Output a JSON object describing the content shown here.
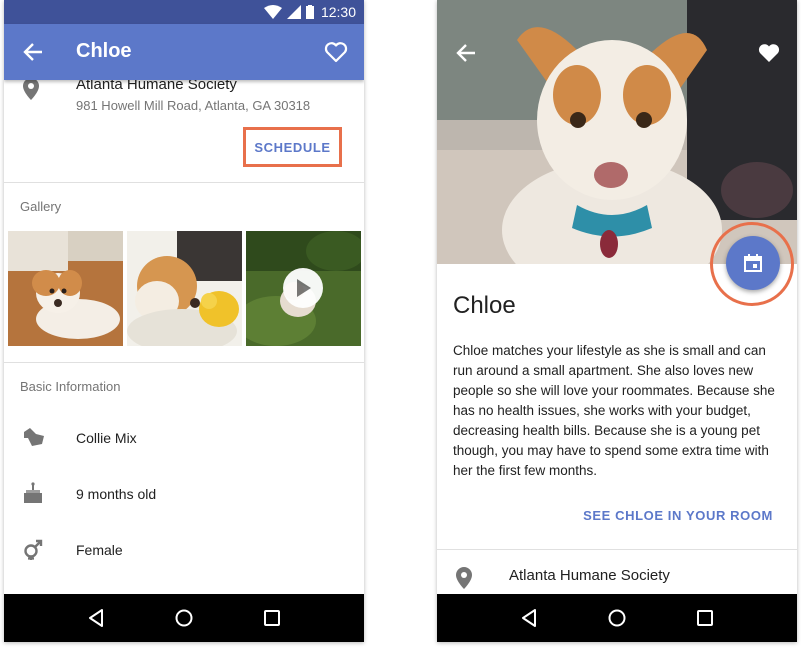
{
  "left_screen": {
    "status_bar": {
      "time": "12:30"
    },
    "app_bar": {
      "title": "Chloe"
    },
    "location": {
      "name": "Atlanta Humane Society",
      "address": "981 Howell Mill Road, Atlanta, GA 30318"
    },
    "schedule_label": "SCHEDULE",
    "gallery": {
      "label": "Gallery",
      "items": [
        "photo",
        "photo",
        "video"
      ]
    },
    "basic_info": {
      "label": "Basic Information",
      "items": [
        {
          "icon": "dog-breed-icon",
          "text": "Collie Mix"
        },
        {
          "icon": "cake-icon",
          "text": "9 months old"
        },
        {
          "icon": "gender-icon",
          "text": "Female"
        }
      ]
    }
  },
  "right_screen": {
    "pet_name": "Chloe",
    "description": "Chloe matches your lifestyle as she is small and can run around a small apartment. She also loves new people so she will love your roommates. Because she has no health issues, she works with your budget, decreasing health bills. Because she is a young pet though, you may have to spend some extra time with her the first few months.",
    "see_room_label": "SEE CHLOE IN YOUR ROOM",
    "location": {
      "name": "Atlanta Humane Society"
    }
  },
  "colors": {
    "primary": "#5c78c9",
    "status_bar": "#3f5299",
    "highlight": "#e8704b"
  }
}
